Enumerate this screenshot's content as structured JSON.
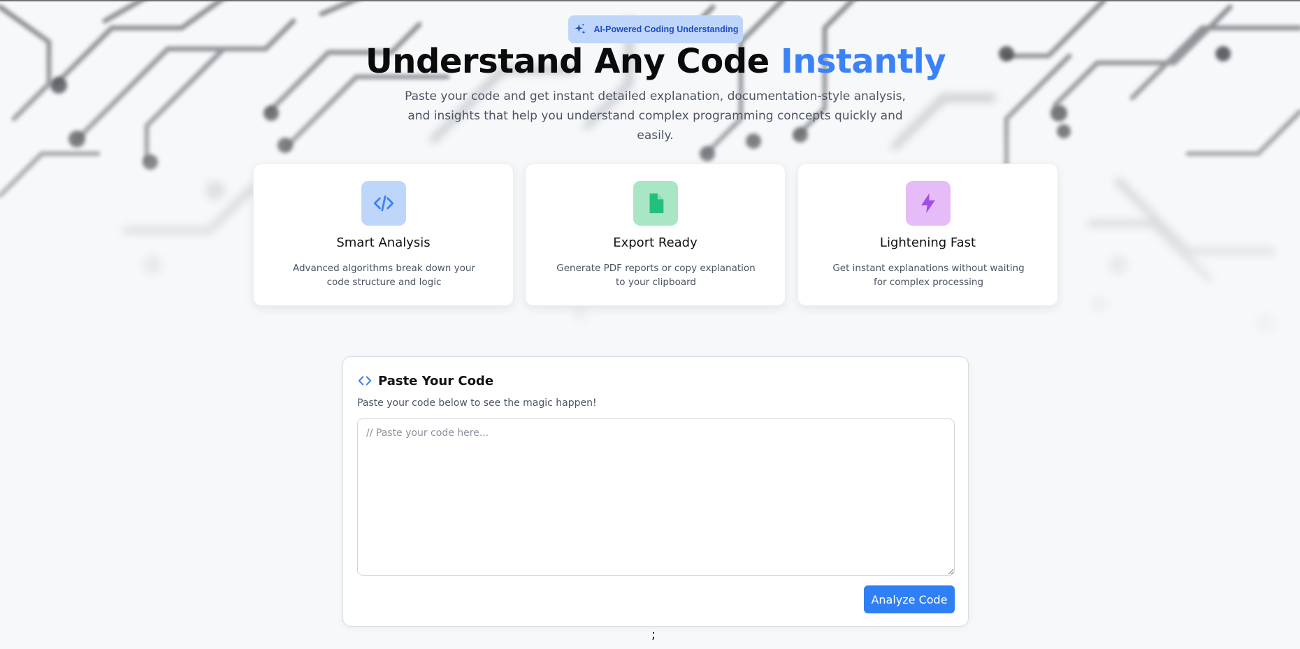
{
  "badge": {
    "icon": "sparkles-icon",
    "label": "AI-Powered Coding Understanding"
  },
  "hero": {
    "title_main": "Understand Any Code ",
    "title_accent": "Instantly",
    "subtitle": "Paste your code and get instant detailed explanation, documentation-style analysis, and insights that help you understand complex programming concepts quickly and easily."
  },
  "features": [
    {
      "icon": "code-icon",
      "title": "Smart Analysis",
      "description": "Advanced algorithms break down your code structure and logic"
    },
    {
      "icon": "file-icon",
      "title": "Export Ready",
      "description": "Generate PDF reports or copy explanation to your clipboard"
    },
    {
      "icon": "lightning-icon",
      "title": "Lightening Fast",
      "description": "Get instant explanations without waiting for complex processing"
    }
  ],
  "editor": {
    "icon": "code-icon",
    "title": "Paste Your Code",
    "subtitle": "Paste your code below to see the magic happen!",
    "placeholder": "// Paste your code here...",
    "button_label": "Analyze Code"
  },
  "footer_text": ";",
  "colors": {
    "accent": "#3b82f6",
    "badge_bg": "#bfd6fb",
    "card1_icon_bg": "#bfd6fb",
    "card2_icon_bg": "#a9e6c6",
    "card3_icon_bg": "#e5bcf7",
    "button_bg": "#2f7ff5"
  }
}
